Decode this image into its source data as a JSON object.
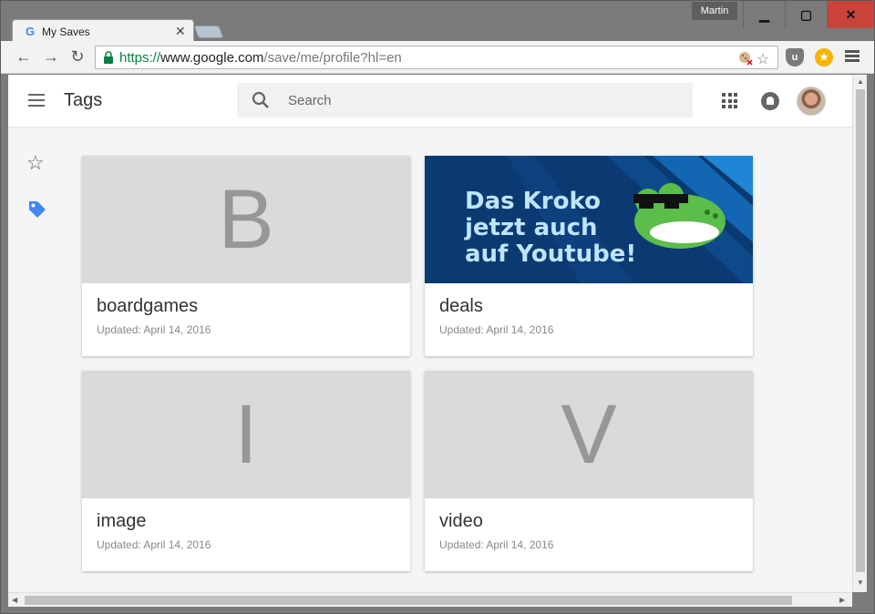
{
  "window": {
    "user_label": "Martin",
    "min_glyph": "▁",
    "max_glyph": "▢",
    "close_glyph": "✕"
  },
  "tab": {
    "favicon_letter": "G",
    "title": "My Saves",
    "close_glyph": "✕"
  },
  "toolbar": {
    "back_glyph": "←",
    "forward_glyph": "→",
    "reload_glyph": "↻",
    "url_scheme": "https://",
    "url_host": "www.google.com",
    "url_path": "/save/me/profile?hl=en",
    "star_glyph": "☆"
  },
  "extensions": [
    {
      "name": "ublock-icon",
      "glyph": "u",
      "color": "#7a7a7a"
    },
    {
      "name": "keep-icon",
      "glyph": "★",
      "color": "#f4b400"
    }
  ],
  "app": {
    "title": "Tags",
    "search_placeholder": "Search"
  },
  "sidebar": {
    "star_glyph": "☆"
  },
  "cards": [
    {
      "name": "boardgames",
      "letter": "B",
      "updated": "Updated: April 14, 2016"
    },
    {
      "name": "deals",
      "letter": "",
      "updated": "Updated: April 14, 2016",
      "banner_text": "Das Kroko jetzt auch auf Youtube!"
    },
    {
      "name": "image",
      "letter": "I",
      "updated": "Updated: April 14, 2016"
    },
    {
      "name": "video",
      "letter": "V",
      "updated": "Updated: April 14, 2016"
    }
  ],
  "colors": {
    "accent_blue": "#4285f4",
    "close_red": "#c9453b",
    "banner_bg": "#0b3a72",
    "croc_green": "#5bbd4a"
  }
}
